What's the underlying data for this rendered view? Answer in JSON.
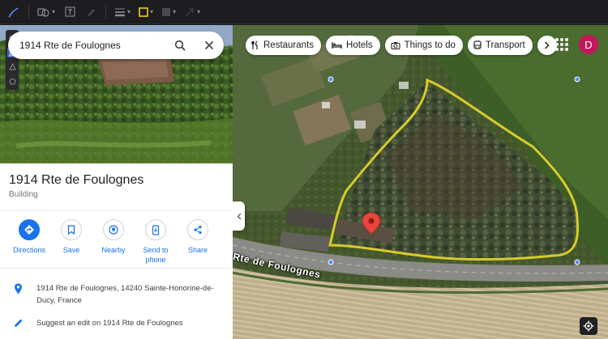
{
  "toolbar": {
    "tools": [
      "pen-tool",
      "shape-tool",
      "text-tool",
      "highlighter-tool",
      "line-weight-tool",
      "fill-color-tool",
      "opacity-tool",
      "arrow-tool"
    ],
    "accent_color": "#5b8df5",
    "fill_swatch_color": "#f2d31a"
  },
  "search": {
    "query": "1914 Rte de Foulognes"
  },
  "place": {
    "title": "1914 Rte de Foulognes",
    "type": "Building",
    "address": "1914 Rte de Foulognes, 14240 Sainte-Honorine-de-Ducy, France",
    "suggest_edit": "Suggest an edit on 1914 Rte de Foulognes"
  },
  "actions": [
    {
      "label": "Directions",
      "icon": "directions-icon"
    },
    {
      "label": "Save",
      "icon": "bookmark-icon"
    },
    {
      "label": "Nearby",
      "icon": "nearby-icon"
    },
    {
      "label": "Send to phone",
      "icon": "send-to-phone-icon"
    },
    {
      "label": "Share",
      "icon": "share-icon"
    }
  ],
  "map": {
    "chips": [
      {
        "label": "Restaurants",
        "icon": "restaurant-icon"
      },
      {
        "label": "Hotels",
        "icon": "hotel-icon"
      },
      {
        "label": "Things to do",
        "icon": "camera-icon"
      },
      {
        "label": "Transport",
        "icon": "transit-icon"
      }
    ],
    "road_label": "Rte de Foulognes",
    "account_initial": "D",
    "avatar_color": "#c2185b",
    "outline_color": "#d6cc2c",
    "pin_color": "#e8453c"
  }
}
